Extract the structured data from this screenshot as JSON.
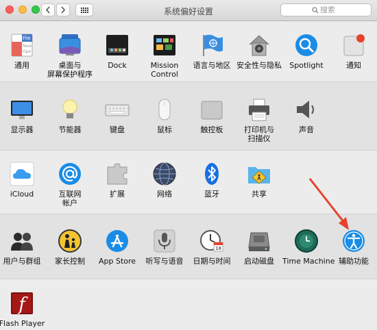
{
  "window": {
    "title": "系统偏好设置",
    "search_placeholder": "搜索"
  },
  "rows": [
    {
      "items": [
        {
          "label": "通用",
          "label2": ""
        },
        {
          "label": "桌面与",
          "label2": "屏幕保护程序"
        },
        {
          "label": "Dock",
          "label2": ""
        },
        {
          "label": "Mission",
          "label2": "Control"
        },
        {
          "label": "语言与地区",
          "label2": ""
        },
        {
          "label": "安全性与隐私",
          "label2": ""
        },
        {
          "label": "Spotlight",
          "label2": ""
        },
        {
          "label": "通知",
          "label2": ""
        }
      ]
    },
    {
      "items": [
        {
          "label": "显示器",
          "label2": ""
        },
        {
          "label": "节能器",
          "label2": ""
        },
        {
          "label": "键盘",
          "label2": ""
        },
        {
          "label": "鼠标",
          "label2": ""
        },
        {
          "label": "触控板",
          "label2": ""
        },
        {
          "label": "打印机与",
          "label2": "扫描仪"
        },
        {
          "label": "声音",
          "label2": ""
        }
      ]
    },
    {
      "items": [
        {
          "label": "iCloud",
          "label2": ""
        },
        {
          "label": "互联网",
          "label2": "帐户"
        },
        {
          "label": "扩展",
          "label2": ""
        },
        {
          "label": "网络",
          "label2": ""
        },
        {
          "label": "蓝牙",
          "label2": ""
        },
        {
          "label": "共享",
          "label2": ""
        }
      ]
    },
    {
      "items": [
        {
          "label": "用户与群组",
          "label2": ""
        },
        {
          "label": "家长控制",
          "label2": ""
        },
        {
          "label": "App Store",
          "label2": ""
        },
        {
          "label": "听写与语音",
          "label2": ""
        },
        {
          "label": "日期与时间",
          "label2": ""
        },
        {
          "label": "启动磁盘",
          "label2": ""
        },
        {
          "label": "Time Machine",
          "label2": ""
        },
        {
          "label": "辅助功能",
          "label2": ""
        }
      ]
    },
    {
      "items": [
        {
          "label": "Flash Player",
          "label2": ""
        }
      ]
    }
  ],
  "icon_texts": {
    "general_file": "File",
    "general_new": "New",
    "general_ope": "Ope",
    "calendar_day": "18",
    "flash_letter": "f"
  },
  "colors": {
    "accent_blue": "#1a8ce6",
    "annotation_arrow": "#e8412c"
  }
}
